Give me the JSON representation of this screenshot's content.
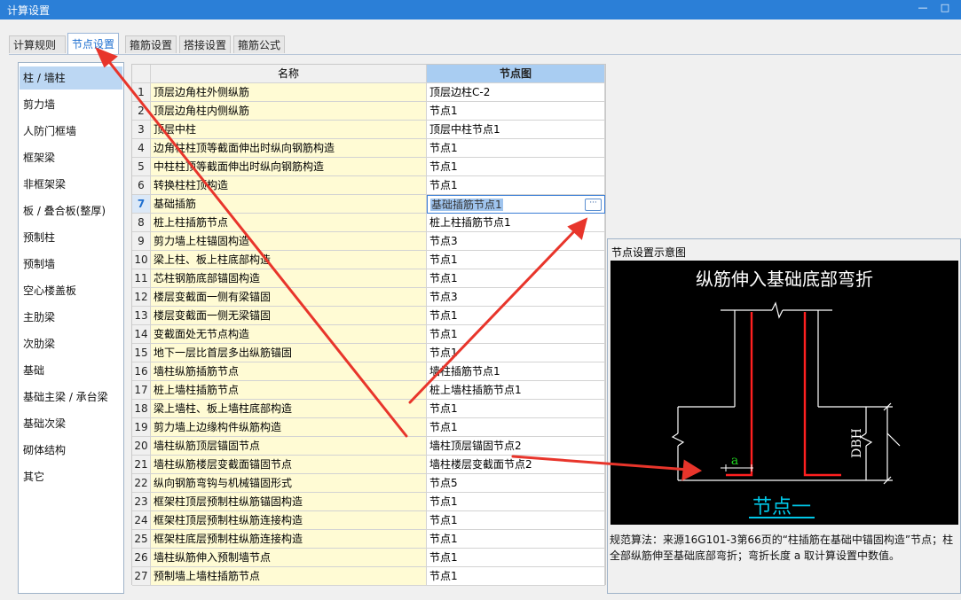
{
  "window": {
    "title": "计算设置"
  },
  "tabs": [
    {
      "label": "计算规则"
    },
    {
      "label": "节点设置"
    },
    {
      "label": "箍筋设置"
    },
    {
      "label": "搭接设置"
    },
    {
      "label": "箍筋公式"
    }
  ],
  "sidebar": {
    "items": [
      {
        "label": "柱 / 墙柱"
      },
      {
        "label": "剪力墙"
      },
      {
        "label": "人防门框墙"
      },
      {
        "label": "框架梁"
      },
      {
        "label": "非框架梁"
      },
      {
        "label": "板 / 叠合板(整厚)"
      },
      {
        "label": "预制柱"
      },
      {
        "label": "预制墙"
      },
      {
        "label": "空心楼盖板"
      },
      {
        "label": "主肋梁"
      },
      {
        "label": "次肋梁"
      },
      {
        "label": "基础"
      },
      {
        "label": "基础主梁 / 承台梁"
      },
      {
        "label": "基础次梁"
      },
      {
        "label": "砌体结构"
      },
      {
        "label": "其它"
      }
    ]
  },
  "grid": {
    "headers": {
      "name": "名称",
      "node": "节点图"
    },
    "rows": [
      {
        "num": "1",
        "name": "顶层边角柱外侧纵筋",
        "node": "顶层边柱C-2"
      },
      {
        "num": "2",
        "name": "顶层边角柱内侧纵筋",
        "node": "节点1"
      },
      {
        "num": "3",
        "name": "顶层中柱",
        "node": "顶层中柱节点1"
      },
      {
        "num": "4",
        "name": "边角柱柱顶等截面伸出时纵向钢筋构造",
        "node": "节点1"
      },
      {
        "num": "5",
        "name": "中柱柱顶等截面伸出时纵向钢筋构造",
        "node": "节点1"
      },
      {
        "num": "6",
        "name": "转换柱柱顶构造",
        "node": "节点1"
      },
      {
        "num": "7",
        "name": "基础插筋",
        "node": "基础插筋节点1"
      },
      {
        "num": "8",
        "name": "桩上柱插筋节点",
        "node": "桩上柱插筋节点1"
      },
      {
        "num": "9",
        "name": "剪力墙上柱锚固构造",
        "node": "节点3"
      },
      {
        "num": "10",
        "name": "梁上柱、板上柱底部构造",
        "node": "节点1"
      },
      {
        "num": "11",
        "name": "芯柱钢筋底部锚固构造",
        "node": "节点1"
      },
      {
        "num": "12",
        "name": "楼层变截面一侧有梁锚固",
        "node": "节点3"
      },
      {
        "num": "13",
        "name": "楼层变截面一侧无梁锚固",
        "node": "节点1"
      },
      {
        "num": "14",
        "name": "变截面处无节点构造",
        "node": "节点1"
      },
      {
        "num": "15",
        "name": "地下一层比首层多出纵筋锚固",
        "node": "节点1"
      },
      {
        "num": "16",
        "name": "墙柱纵筋插筋节点",
        "node": "墙柱插筋节点1"
      },
      {
        "num": "17",
        "name": "桩上墙柱插筋节点",
        "node": "桩上墙柱插筋节点1"
      },
      {
        "num": "18",
        "name": "梁上墙柱、板上墙柱底部构造",
        "node": "节点1"
      },
      {
        "num": "19",
        "name": "剪力墙上边缘构件纵筋构造",
        "node": "节点1"
      },
      {
        "num": "20",
        "name": "墙柱纵筋顶层锚固节点",
        "node": "墙柱顶层锚固节点2"
      },
      {
        "num": "21",
        "name": "墙柱纵筋楼层变截面锚固节点",
        "node": "墙柱楼层变截面节点2"
      },
      {
        "num": "22",
        "name": "纵向钢筋弯钩与机械锚固形式",
        "node": "节点5"
      },
      {
        "num": "23",
        "name": "框架柱顶层预制柱纵筋锚固构造",
        "node": "节点1"
      },
      {
        "num": "24",
        "name": "框架柱顶层预制柱纵筋连接构造",
        "node": "节点1"
      },
      {
        "num": "25",
        "name": "框架柱底层预制柱纵筋连接构造",
        "node": "节点1"
      },
      {
        "num": "26",
        "name": "墙柱纵筋伸入预制墙节点",
        "node": "节点1"
      },
      {
        "num": "27",
        "name": "预制墙上墙柱插筋节点",
        "node": "节点1"
      }
    ]
  },
  "preview": {
    "title": "节点设置示意图",
    "diagram": {
      "heading": "纵筋伸入基础底部弯折",
      "label_a": "a",
      "label_dbh": "DBH",
      "caption": "节点一"
    },
    "description": "规范算法：来源16G101-3第66页的“柱插筋在基础中锚固构造”节点；柱全部纵筋伸至基础底部弯折；弯折长度 a 取计算设置中数值。"
  },
  "colors": {
    "titlebar": "#2b7fd7",
    "name_cell": "#fffbd4",
    "header_node": "#a9cdf2",
    "selection": "#bcd7f3",
    "arrow": "#e8352b",
    "rebar": "#ff2020",
    "caption": "#00c8e8"
  }
}
